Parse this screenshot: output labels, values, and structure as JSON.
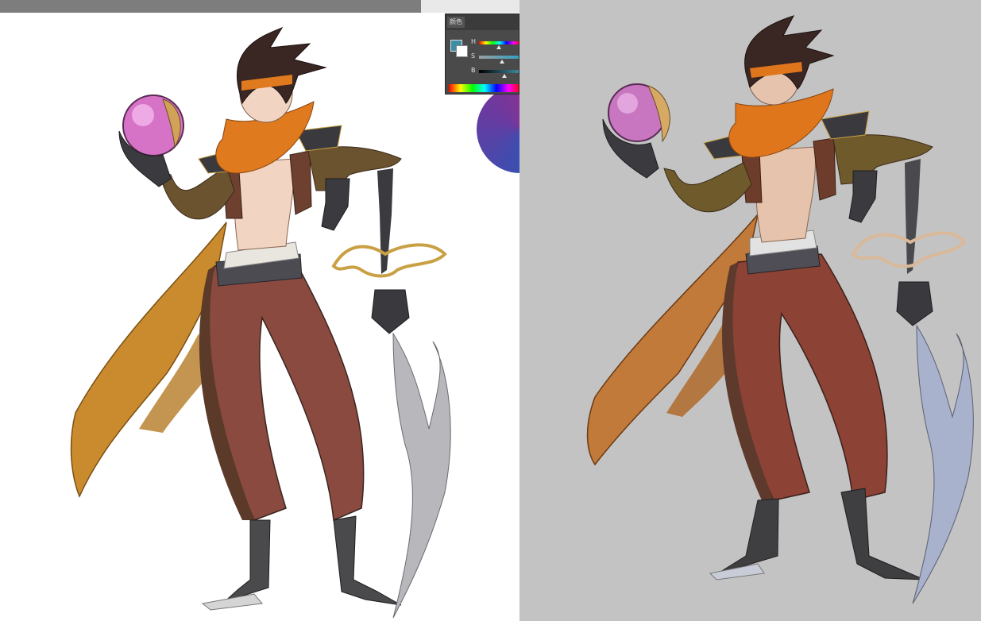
{
  "color_panel": {
    "tab_label": "颜色",
    "sliders": [
      {
        "label": "H",
        "value": 0.49
      },
      {
        "label": "S",
        "value": 0.56
      },
      {
        "label": "B",
        "value": 0.61
      }
    ],
    "foreground_color": "#3d8fa4",
    "background_color": "#ffffff"
  },
  "canvases": {
    "left_background": "#ffffff",
    "right_background": "#c3c3c3"
  }
}
